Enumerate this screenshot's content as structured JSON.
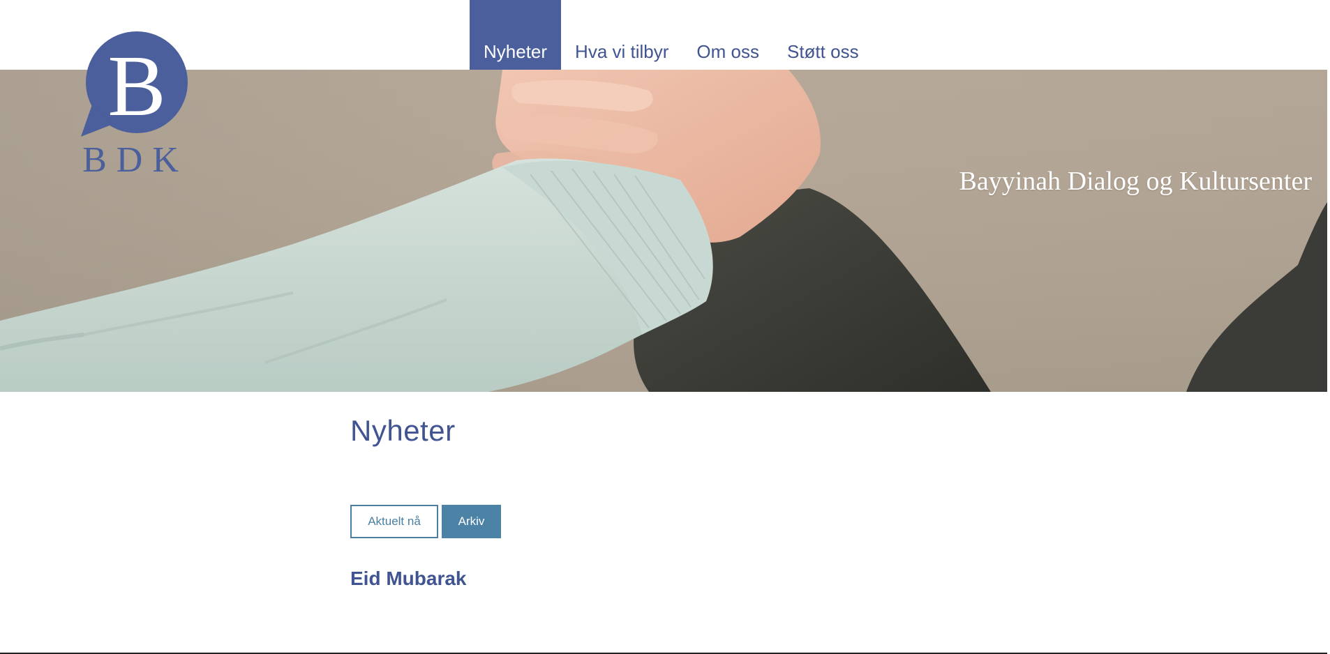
{
  "logo": {
    "letter": "B",
    "initials": "BDK",
    "color": "#4a5f9c"
  },
  "nav": {
    "items": [
      {
        "label": "Nyheter",
        "active": true
      },
      {
        "label": "Hva vi tilbyr",
        "active": false
      },
      {
        "label": "Om oss",
        "active": false
      },
      {
        "label": "Støtt oss",
        "active": false
      }
    ],
    "active_color": "#4a5f9c"
  },
  "hero": {
    "tagline": "Bayyinah Dialog og Kultursenter"
  },
  "main": {
    "title": "Nyheter",
    "filters": {
      "current_label": "Aktuelt nå",
      "archive_label": "Arkiv"
    },
    "articles": [
      {
        "title": "Eid Mubarak"
      }
    ]
  },
  "colors": {
    "brand": "#4a5f9c",
    "button": "#4b82a5"
  }
}
